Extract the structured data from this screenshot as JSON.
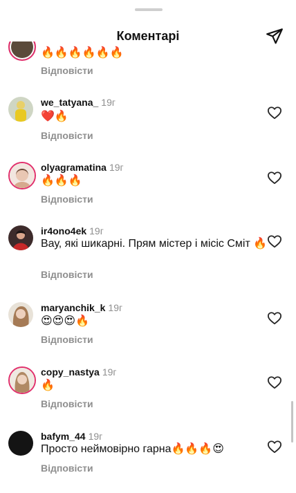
{
  "header": {
    "title": "Коментарі",
    "send_icon": "send-icon"
  },
  "reply_label": "Відповісти",
  "top_partial": {
    "text": "🔥🔥🔥🔥🔥🔥",
    "reply": "Відповісти"
  },
  "comments": [
    {
      "username": "we_tatyana_",
      "time": "19г",
      "text": "❤️🔥",
      "reply": "Відповісти"
    },
    {
      "username": "olyagramatina",
      "time": "19г",
      "text": "🔥🔥🔥",
      "reply": "Відповісти"
    },
    {
      "username": "ir4ono4ek",
      "time": "19г",
      "text": "Вау, які шикарні. Прям містер і місіс Сміт 🔥",
      "reply": "Відповісти"
    },
    {
      "username": "maryanchik_k",
      "time": "19г",
      "text": "😍😍😍🔥",
      "reply": "Відповісти"
    },
    {
      "username": "copy_nastya",
      "time": "19г",
      "text": "🔥",
      "reply": "Відповісти"
    },
    {
      "username": "bafym_44",
      "time": "19г",
      "text": "Просто неймовірно гарна🔥🔥🔥😍",
      "reply": "Відповісти"
    }
  ],
  "colors": {
    "ring": "#e1306c",
    "secondary_text": "#8e8e8e"
  }
}
